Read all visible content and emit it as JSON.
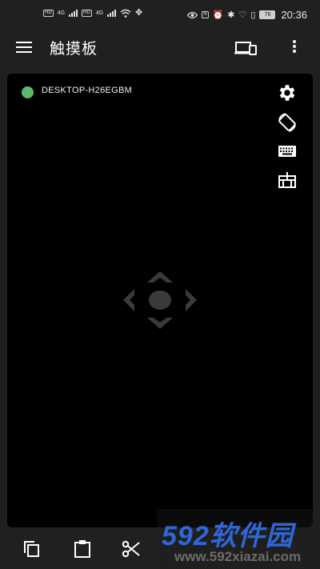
{
  "status_bar": {
    "hd_1": "HD",
    "hd_2": "HD",
    "net_1": "4G",
    "net_2": "4G",
    "nfc": "N",
    "battery": "76",
    "time": "20:36",
    "icons": [
      "signal-icon",
      "wifi-icon",
      "usb-icon",
      "eye-icon",
      "nfc-icon",
      "alarm-icon",
      "bluetooth-icon",
      "location-icon",
      "vibrate-icon",
      "battery-icon"
    ]
  },
  "app_bar": {
    "title": "触摸板",
    "icons": [
      "menu-icon",
      "devices-icon",
      "more-vert-icon"
    ]
  },
  "touchpad": {
    "device_name": "DESKTOP-H26EGBM",
    "connection_color": "#5fb96b",
    "side_icons": [
      "settings-icon",
      "rotate-icon",
      "keyboard-icon",
      "mouse-buttons-icon"
    ],
    "center_icon": "dpad-move-icon"
  },
  "toolbar": {
    "icons": [
      "copy-icon",
      "clipboard-icon",
      "cut-icon"
    ]
  },
  "watermark": {
    "logo": "592软件园",
    "url": "www.592xiazai.com"
  }
}
